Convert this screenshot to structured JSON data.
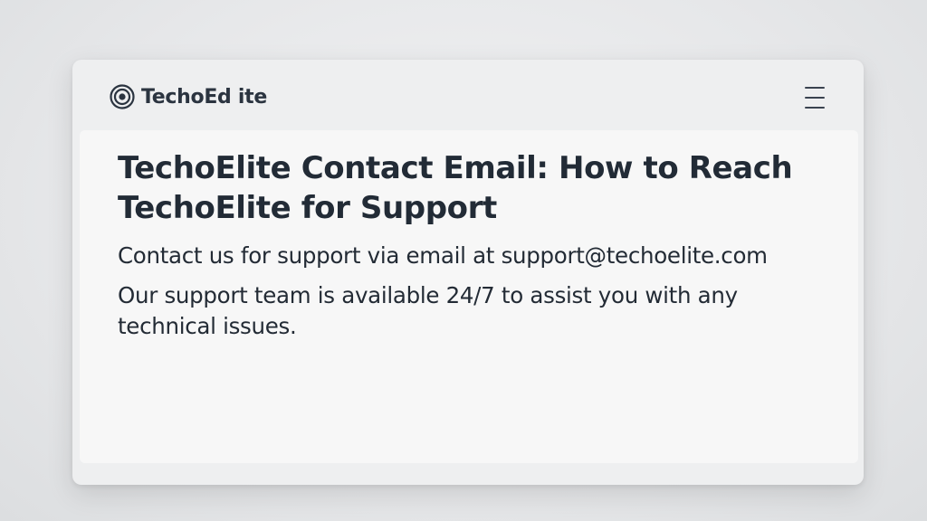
{
  "header": {
    "brand_name": "TechoEd ite",
    "brand_icon": "concentric-circles-logo",
    "menu_icon": "hamburger-menu-icon"
  },
  "main": {
    "title": "TechoElite Contact Email: How to Reach TechoElite for Support",
    "paragraphs": [
      "Contact us for support via email at support@techoelite.com",
      "Our support team is available 24/7 to assist you with any technical issues."
    ]
  },
  "colors": {
    "background": "#e6e7e9",
    "window": "#eeeff0",
    "content": "#f7f7f7",
    "text": "#222b36"
  }
}
